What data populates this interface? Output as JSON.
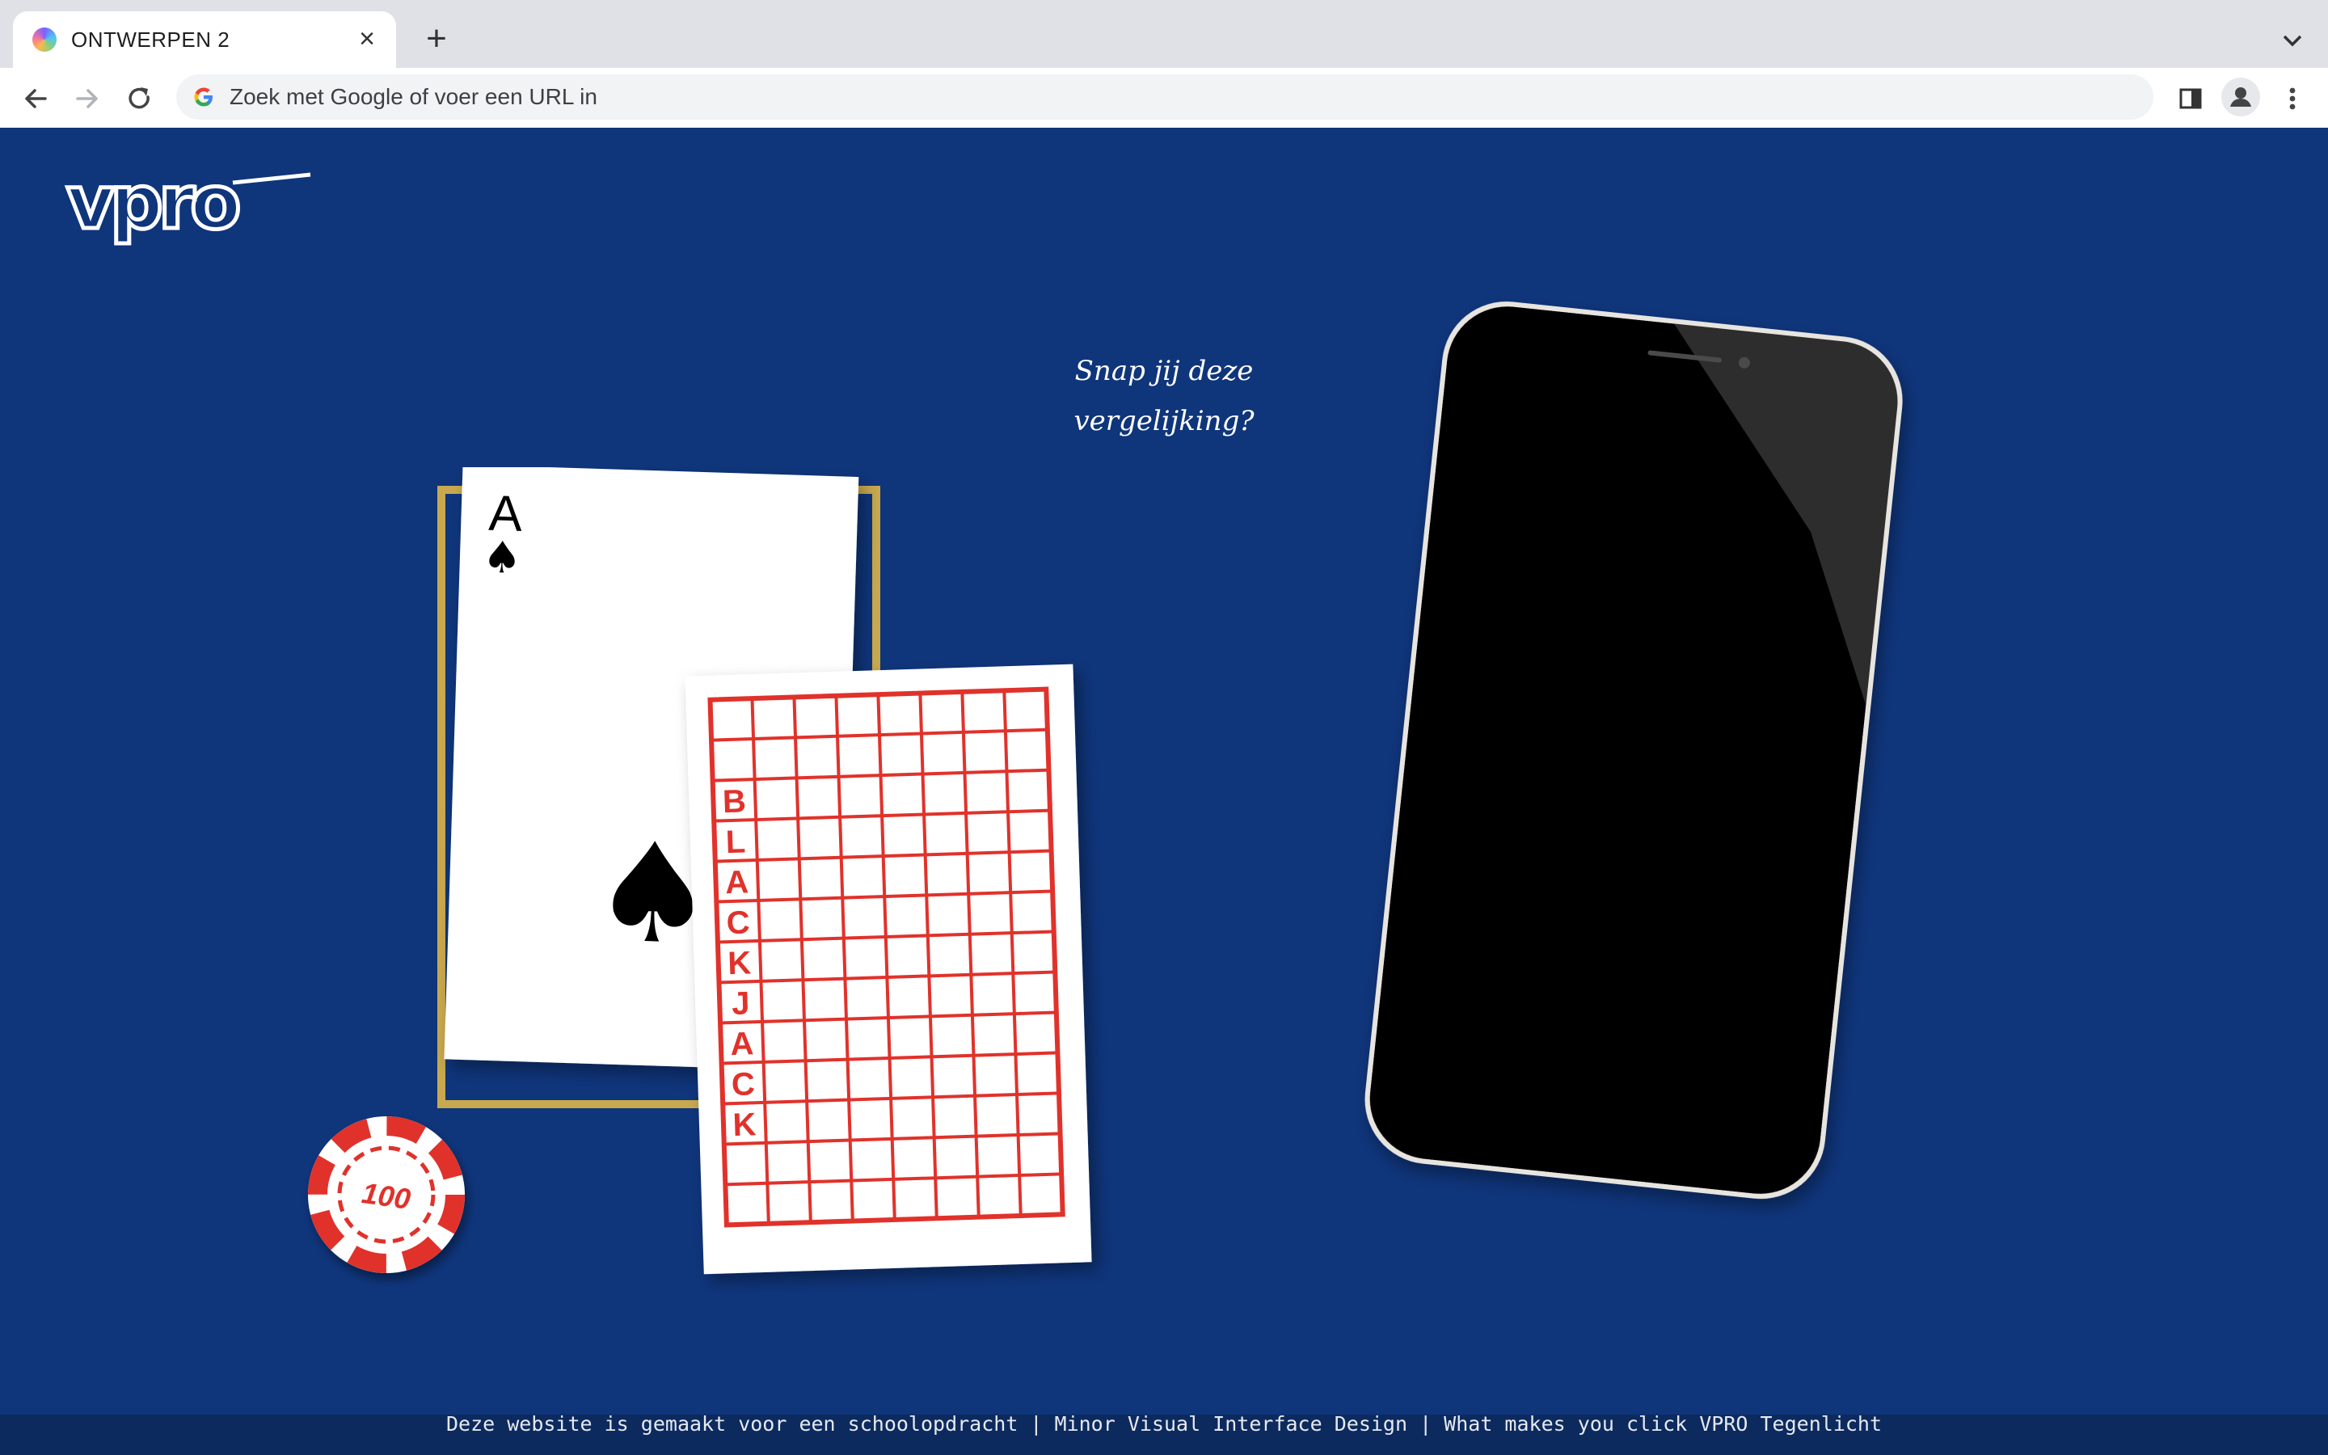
{
  "browser": {
    "tab": {
      "title": "ONTWERPEN 2",
      "close_icon": "close-icon",
      "favicon": "chrome-favicon-icon"
    },
    "new_tab_icon": "plus-icon",
    "omnibox": {
      "placeholder": "Zoek met Google of voer een URL in",
      "value": ""
    }
  },
  "page": {
    "logo_text": "vpro",
    "caption_line1": "Snap jij deze",
    "caption_line2": "vergelijking?",
    "ace_card": {
      "rank": "A",
      "suit": "♠"
    },
    "word_card": {
      "letters": [
        "B",
        "L",
        "A",
        "C",
        "K",
        "J",
        "A",
        "C",
        "K"
      ]
    },
    "chip": {
      "value": "100"
    },
    "footer": "Deze website is gemaakt voor een schoolopdracht | Minor Visual Interface Design | What makes you click VPRO Tegenlicht"
  },
  "colors": {
    "background": "#0f357b",
    "gold_frame": "#c9a94f",
    "red": "#e0322b",
    "phone_body": "#000000",
    "phone_rim": "#e8e4df"
  }
}
